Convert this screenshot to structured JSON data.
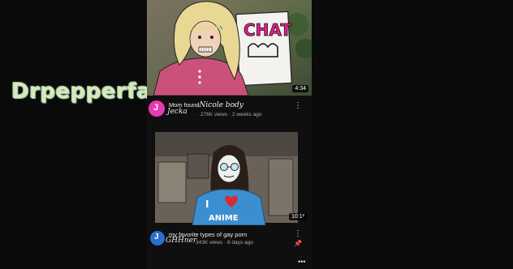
{
  "username": "Drpepperfan!",
  "videos": [
    {
      "title_prefix": "Mom found",
      "title_handwritten": "Nicole body",
      "channel": "Jecka",
      "views": "276K views",
      "age": "2 weeks ago",
      "duration": "4:34",
      "thumb_sign": "CHAT",
      "avatar_letter": "J",
      "avatar_color": "#e83ab0"
    },
    {
      "title": "my favorite types of gay porn",
      "channel": "GHHner",
      "views": "343K views",
      "age": "8 days ago",
      "duration": "10:1²",
      "shirt_text_1": "I",
      "shirt_text_2": "ANIME",
      "avatar_letter": "J",
      "avatar_color": "#2a6fd1"
    }
  ],
  "icons": {
    "menu": "more-vertical-icon",
    "pin": "pin-icon",
    "bottom": "more-horizontal-icon"
  }
}
